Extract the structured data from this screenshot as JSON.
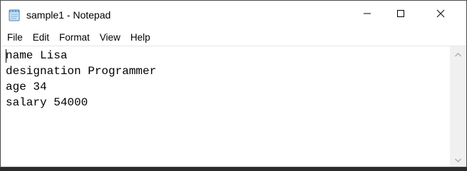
{
  "window": {
    "title": "sample1 - Notepad",
    "app_icon": "notepad-icon",
    "controls": {
      "minimize_icon": "minimize-icon",
      "maximize_icon": "maximize-icon",
      "close_icon": "close-icon"
    }
  },
  "menubar": {
    "items": [
      {
        "label": "File"
      },
      {
        "label": "Edit"
      },
      {
        "label": "Format"
      },
      {
        "label": "View"
      },
      {
        "label": "Help"
      }
    ]
  },
  "editor": {
    "lines": [
      "name Lisa",
      "designation Programmer",
      "age 34",
      "salary 54000"
    ]
  },
  "scrollbar": {
    "up_icon": "chevron-up-icon",
    "down_icon": "chevron-down-icon"
  },
  "colors": {
    "window_bg": "#ffffff",
    "scrollbar_bg": "#f0f0f0",
    "text": "#000000"
  }
}
